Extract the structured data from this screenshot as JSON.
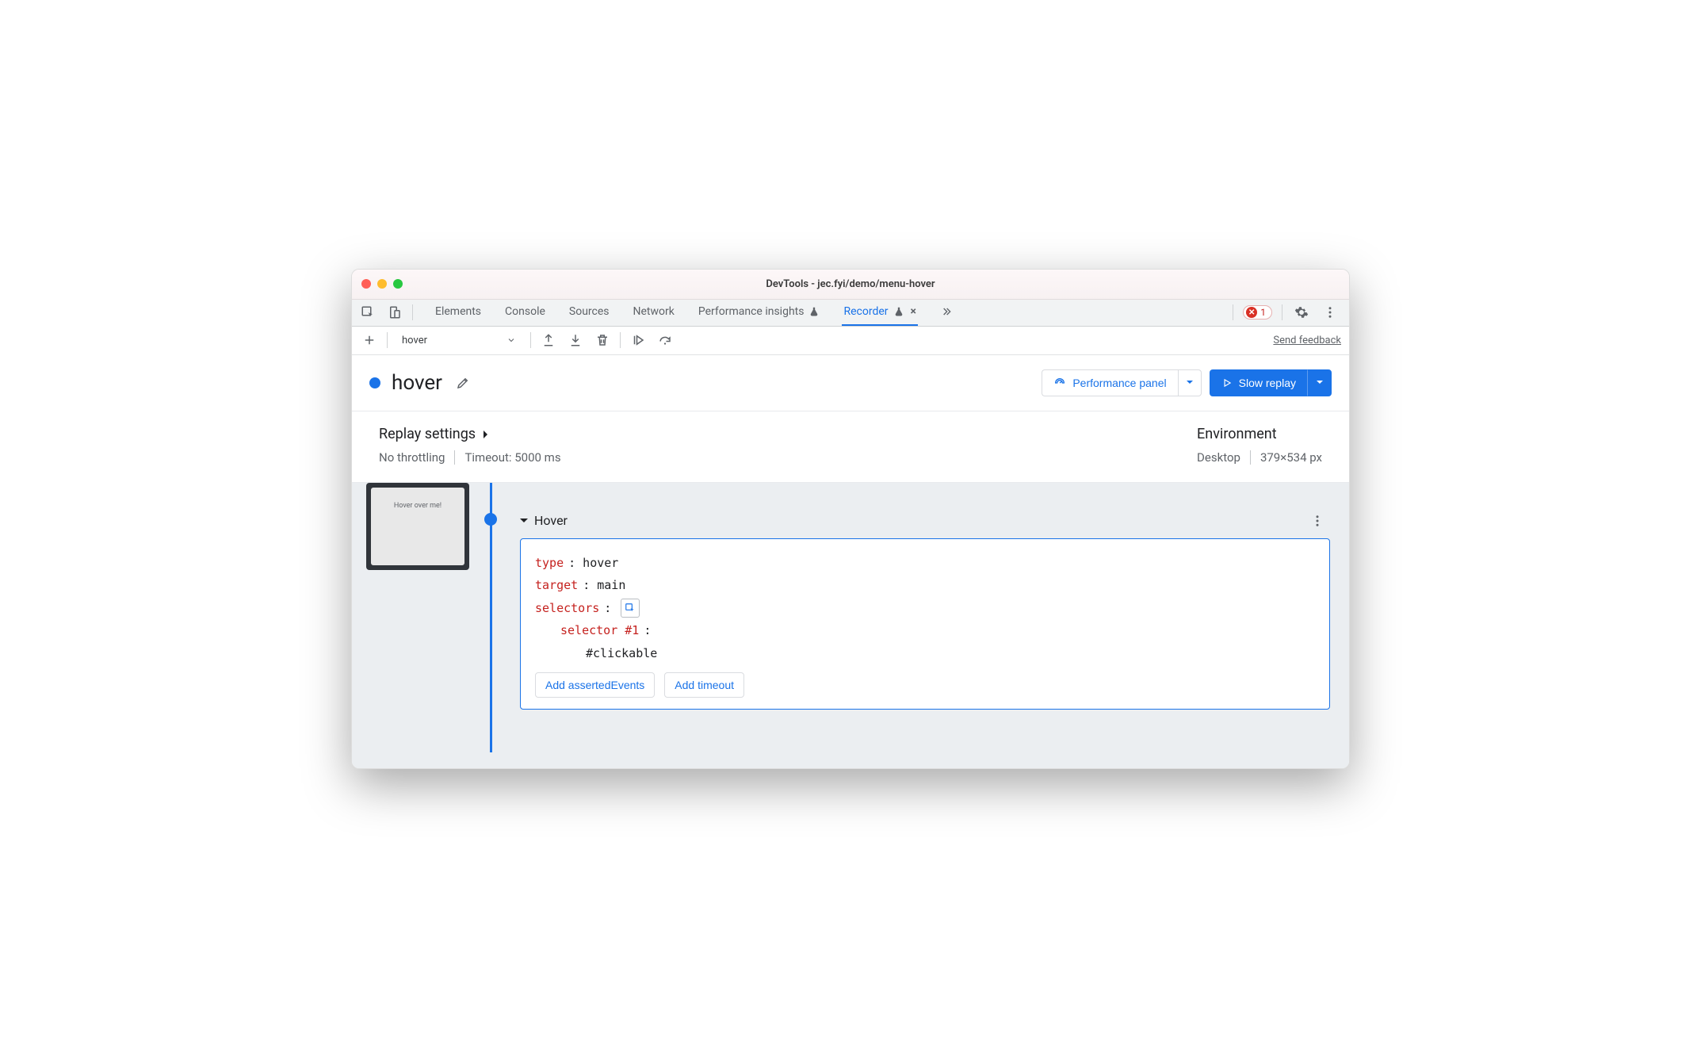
{
  "window": {
    "title": "DevTools - jec.fyi/demo/menu-hover"
  },
  "tabs": {
    "items": [
      {
        "label": "Elements"
      },
      {
        "label": "Console"
      },
      {
        "label": "Sources"
      },
      {
        "label": "Network"
      },
      {
        "label": "Performance insights"
      },
      {
        "label": "Recorder"
      }
    ],
    "error_count": "1"
  },
  "toolbar": {
    "recording_name": "hover",
    "feedback": "Send feedback"
  },
  "recording": {
    "title": "hover",
    "perf_btn": "Performance panel",
    "replay_btn": "Slow replay"
  },
  "settings": {
    "replay_title": "Replay settings",
    "throttling": "No throttling",
    "timeout": "Timeout: 5000 ms",
    "env_title": "Environment",
    "device": "Desktop",
    "dimensions": "379×534 px"
  },
  "thumbnail": {
    "label": "Hover over me!"
  },
  "step": {
    "title": "Hover",
    "type_key": "type",
    "type_val": ": hover",
    "target_key": "target",
    "target_val": ": main",
    "selectors_key": "selectors",
    "selectors_colon": ":",
    "selector1_key": "selector #1",
    "selector1_colon": ":",
    "selector1_val": "#clickable",
    "add_asserted": "Add assertedEvents",
    "add_timeout": "Add timeout"
  }
}
